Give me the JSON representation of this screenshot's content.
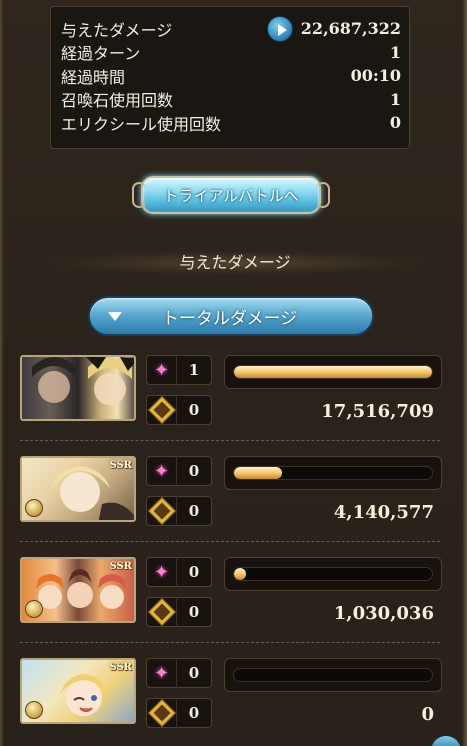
{
  "stats": [
    {
      "label": "与えたダメージ",
      "value": "22,687,322",
      "icon": "play-icon"
    },
    {
      "label": "経過ターン",
      "value": "1"
    },
    {
      "label": "経過時間",
      "value": "00:10"
    },
    {
      "label": "召喚石使用回数",
      "value": "1"
    },
    {
      "label": "エリクシール使用回数",
      "value": "0"
    }
  ],
  "trial_button": {
    "label": "トライアルバトルへ"
  },
  "section_heading": "与えたダメージ",
  "total_dropdown": {
    "label": "トータルダメージ"
  },
  "rows": [
    {
      "portrait": "party-portrait-1",
      "ssr": "",
      "skill_count": "1",
      "ougi_count": "0",
      "bar_fraction": 1.0,
      "damage": "17,516,709"
    },
    {
      "portrait": "party-portrait-2",
      "ssr": "SSR",
      "skill_count": "0",
      "ougi_count": "0",
      "bar_fraction": 0.24,
      "damage": "4,140,577"
    },
    {
      "portrait": "party-portrait-3",
      "ssr": "SSR",
      "skill_count": "0",
      "ougi_count": "0",
      "bar_fraction": 0.06,
      "damage": "1,030,036"
    },
    {
      "portrait": "party-portrait-4",
      "ssr": "SSR",
      "skill_count": "0",
      "ougi_count": "0",
      "bar_fraction": 0.0,
      "damage": "0"
    }
  ],
  "colors": {
    "bar_fill": "#f1c26a",
    "accent_blue": "#4fb6d9",
    "panel_bg": "#1a1612"
  }
}
